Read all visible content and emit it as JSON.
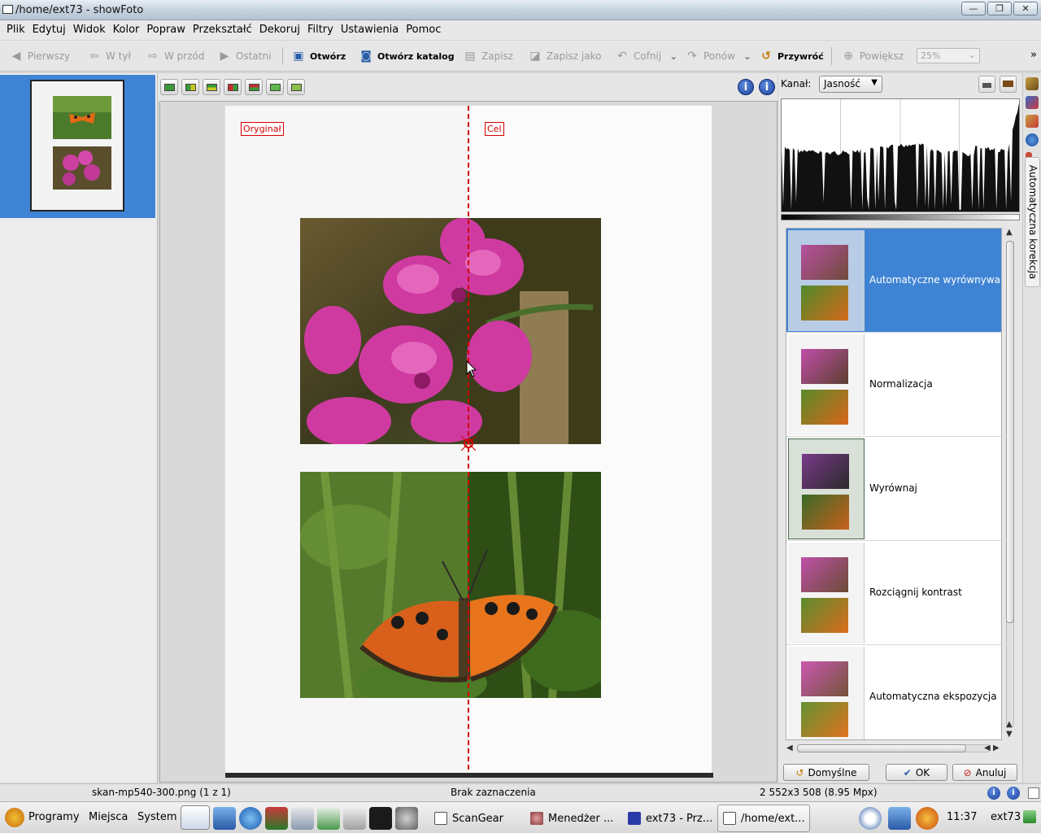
{
  "window": {
    "title": "/home/ext73 - showFoto"
  },
  "menu": [
    "Plik",
    "Edytuj",
    "Widok",
    "Kolor",
    "Popraw",
    "Przekształć",
    "Dekoruj",
    "Filtry",
    "Ustawienia",
    "Pomoc"
  ],
  "toolbar": {
    "first": "Pierwszy",
    "back": "W tył",
    "forward": "W przód",
    "last": "Ostatni",
    "open": "Otwórz",
    "open_folder": "Otwórz katalog",
    "save": "Zapisz",
    "save_as": "Zapisz jako",
    "undo": "Cofnij",
    "redo": "Ponów",
    "revert": "Przywróć",
    "zoom": "Powiększ",
    "zoom_value": "25%"
  },
  "preview": {
    "original_tag": "Oryginał",
    "target_tag": "Cel"
  },
  "right_panel": {
    "channel_label": "Kanał:",
    "channel_value": "Jasność",
    "tab_label": "Automatyczna korekcja",
    "corrections": [
      {
        "label": "Automatyczne wyrównywanie",
        "selected": true
      },
      {
        "label": "Normalizacja",
        "selected": false
      },
      {
        "label": "Wyrównaj",
        "selected": false
      },
      {
        "label": "Rozciągnij kontrast",
        "selected": false
      },
      {
        "label": "Automatyczna ekspozycja",
        "selected": false
      }
    ],
    "buttons": {
      "defaults": "Domyślne",
      "ok": "OK",
      "cancel": "Anuluj"
    }
  },
  "status": {
    "filename": "skan-mp540-300.png (1 z 1)",
    "selection": "Brak zaznaczenia",
    "dimensions": "2 552x3 508 (8.95 Mpx)"
  },
  "taskbar": {
    "menus": [
      "Programy",
      "Miejsca",
      "System"
    ],
    "windows": [
      "ScanGear",
      "Menedżer ...",
      "ext73 - Prz...",
      "/home/ext..."
    ],
    "clock": "11:37",
    "user": "ext73"
  },
  "colors": {
    "selection": "#3f84d4",
    "marker": "#d40000",
    "info": "#1a3f9a"
  }
}
